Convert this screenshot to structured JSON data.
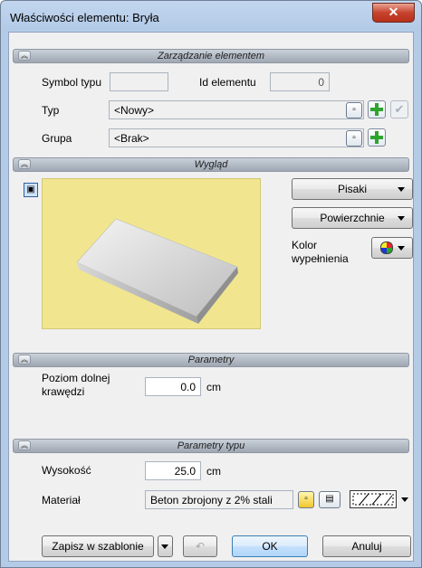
{
  "window": {
    "title": "Właściwości elementu: Bryła",
    "close_glyph": "✕"
  },
  "sections": {
    "zarzadzanie": "Zarządzanie elementem",
    "wyglad": "Wygląd",
    "parametry": "Parametry",
    "parametry_typu": "Parametry typu"
  },
  "zarzadzanie": {
    "symbol_label": "Symbol typu",
    "symbol_value": "",
    "id_label": "Id elementu",
    "id_value": "0",
    "typ_label": "Typ",
    "typ_value": "<Nowy>",
    "grupa_label": "Grupa",
    "grupa_value": "<Brak>"
  },
  "wyglad": {
    "pisaki_label": "Pisaki",
    "powierzchnie_label": "Powierzchnie",
    "kolor_label_1": "Kolor",
    "kolor_label_2": "wypełnienia"
  },
  "parametry": {
    "poziom_label_1": "Poziom dolnej",
    "poziom_label_2": "krawędzi",
    "poziom_value": "0.0",
    "poziom_unit": "cm"
  },
  "parametry_typu": {
    "wysokosc_label": "Wysokość",
    "wysokosc_value": "25.0",
    "wysokosc_unit": "cm",
    "material_label": "Materiał",
    "material_value": "Beton zbrojony z 2% stali"
  },
  "footer": {
    "save_template_label": "Zapisz w szablonie",
    "ok_label": "OK",
    "cancel_label": "Anuluj"
  },
  "colors": {
    "preview_bg": "#f1e68f",
    "title_bar": "#b4cbe8",
    "close_button": "#c6432e",
    "add_green": "#2ea52e"
  },
  "icons": [
    "close-icon",
    "chevron-up-icon",
    "cube-icon",
    "pick-icon",
    "add-icon",
    "check-icon",
    "palette-icon",
    "hatch-pattern-icon",
    "undo-icon",
    "dropdown-arrow-icon"
  ]
}
